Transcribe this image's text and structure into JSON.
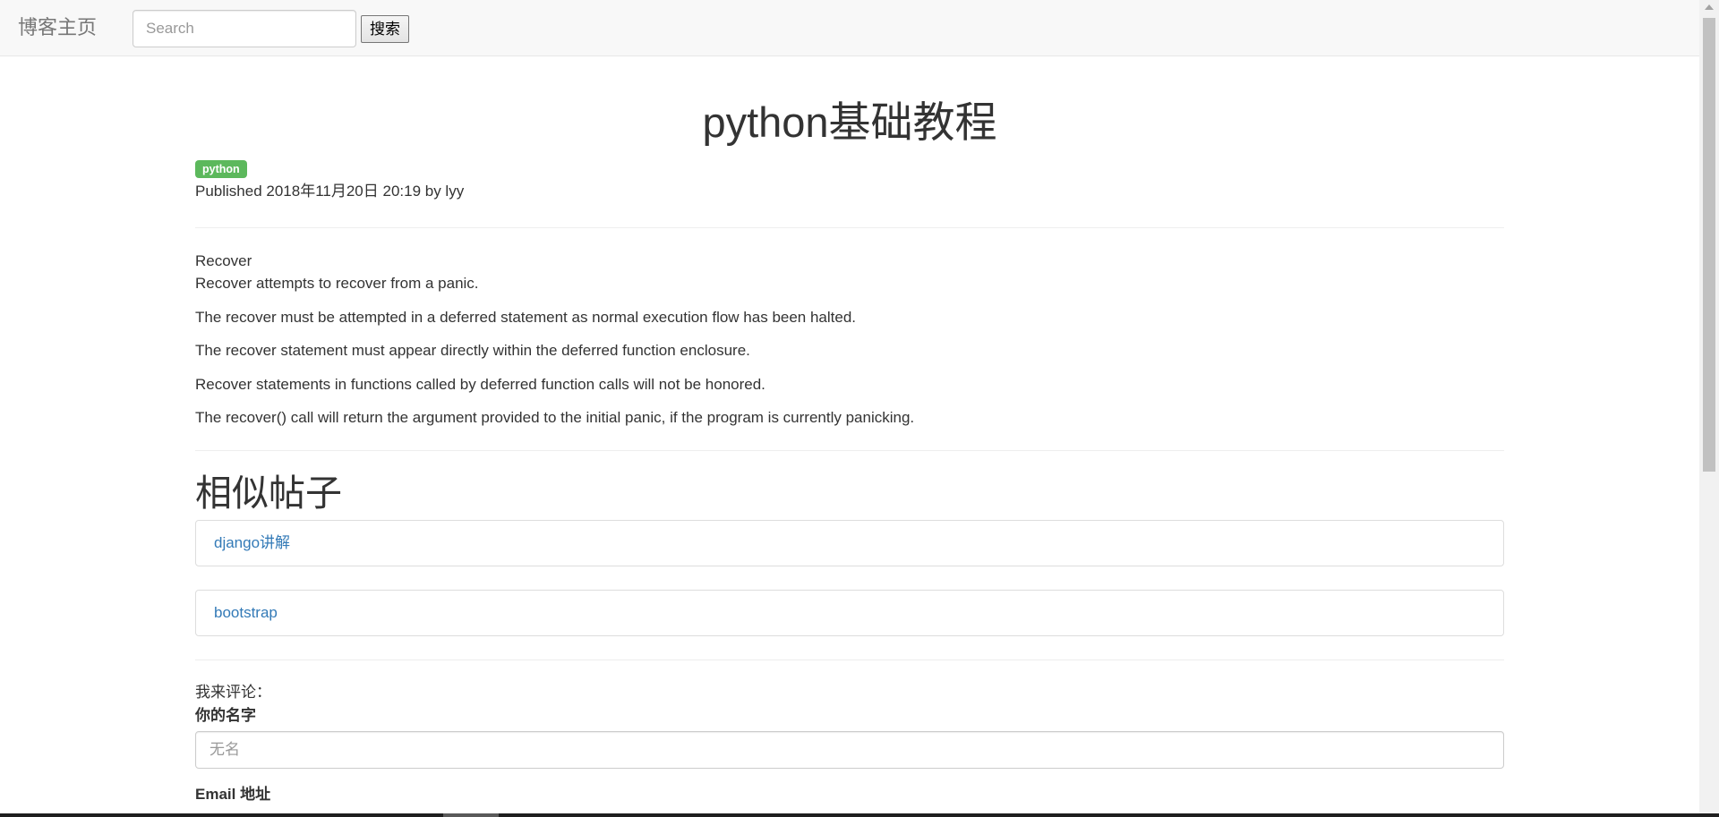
{
  "navbar": {
    "brand": "博客主页",
    "search_placeholder": "Search",
    "search_button": "搜索"
  },
  "post": {
    "title": "python基础教程",
    "tag": "python",
    "meta": "Published 2018年11月20日 20:19 by lyy",
    "body_heading": "Recover",
    "paragraphs": [
      "Recover attempts to recover from a panic.",
      "The recover must be attempted in a deferred statement as normal execution flow has been halted.",
      "The recover statement must appear directly within the deferred function enclosure.",
      "Recover statements in functions called by deferred function calls will not be honored.",
      "The recover() call will return the argument provided to the initial panic, if the program is currently panicking."
    ]
  },
  "similar": {
    "heading": "相似帖子",
    "items": [
      {
        "label": "django讲解"
      },
      {
        "label": "bootstrap"
      }
    ]
  },
  "comment": {
    "intro": "我来评论：",
    "name_label": "你的名字",
    "name_placeholder": "无名",
    "email_label": "Email 地址"
  },
  "colors": {
    "tag_bg": "#5cb85c",
    "link": "#337ab7",
    "navbar_bg": "#f8f8f8"
  }
}
